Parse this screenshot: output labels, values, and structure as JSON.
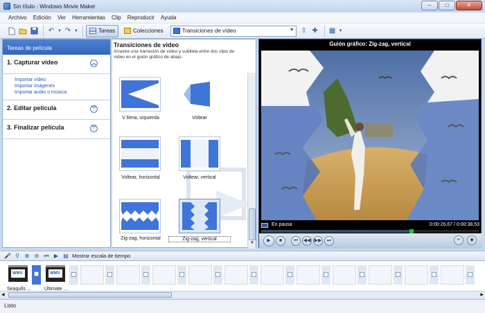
{
  "window": {
    "title": "Sin título - Windows Movie Maker",
    "buttons": [
      "–",
      "□",
      "✕"
    ]
  },
  "menu": [
    "Archivo",
    "Edición",
    "Ver",
    "Herramientas",
    "Clip",
    "Reproducir",
    "Ayuda"
  ],
  "toolbar": {
    "tasks_label": "Tareas",
    "collections_label": "Colecciones",
    "collection_selected": "Transiciones de vídeo"
  },
  "tasks": {
    "header": "Tareas de película",
    "sections": [
      {
        "title": "1. Capturar vídeo",
        "links": [
          "Importar vídeo",
          "Importar imágenes",
          "Importar audio o música"
        ]
      },
      {
        "title": "2. Editar película"
      },
      {
        "title": "3. Finalizar película"
      }
    ]
  },
  "transitions": {
    "title": "Transiciones de vídeo",
    "description": "Arrastre una transición de vídeo y suéltela entre dos clips de vídeo en el guión gráfico de abajo.",
    "items": [
      "V llena, izquierda",
      "Voltear",
      "Voltear, horizontal",
      "Voltear, vertical",
      "Zig-zag, horizontal",
      "Zig-zag, vertical"
    ]
  },
  "preview": {
    "title": "Guión gráfico: Zig-zag, vertical",
    "state": "En pausa",
    "time": "0:00:26,67 / 0:00:38,53",
    "progress": 0.69
  },
  "storyboard": {
    "toggle_label": "Mostrar escala de tiempo",
    "clips": [
      "Seagulls ...",
      "Ultimate ..."
    ],
    "clip_badge": "WMV"
  },
  "status": "Listo",
  "colors": {
    "accent": "#3f74d8",
    "header": "#3465b9",
    "seek": "#22c232"
  }
}
